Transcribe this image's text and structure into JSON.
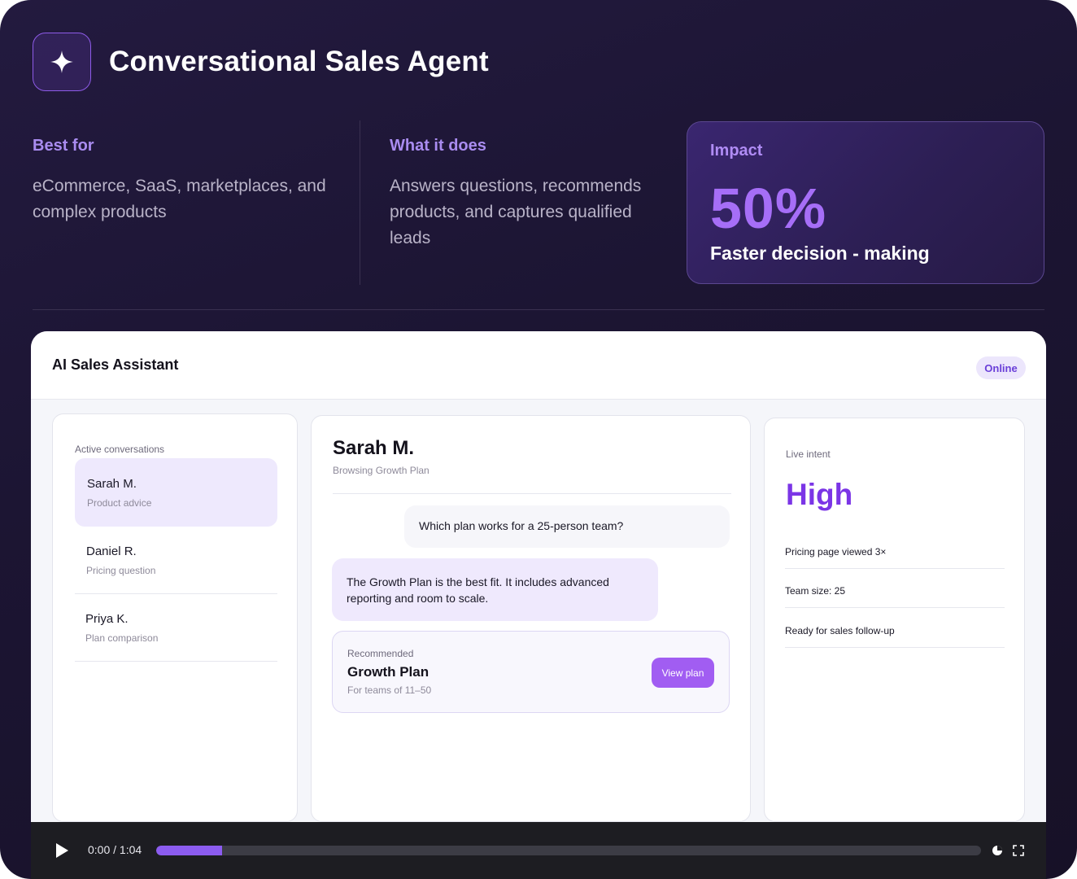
{
  "header": {
    "title": "Conversational Sales Agent",
    "logo_icon": "sparkle-icon"
  },
  "info": {
    "best_for": {
      "label": "Best for",
      "text": "eCommerce, SaaS, marketplaces, and complex products"
    },
    "what_it_does": {
      "label": "What it does",
      "text": "Answers questions, recommends products, and captures qualified leads"
    },
    "impact": {
      "label": "Impact",
      "value": "50%",
      "caption": "Faster decision - making"
    }
  },
  "app": {
    "title": "AI Sales Assistant",
    "status_badge": "Online",
    "conversations": {
      "label": "Active conversations",
      "items": [
        {
          "name": "Sarah M.",
          "topic": "Product advice"
        },
        {
          "name": "Daniel R.",
          "topic": "Pricing question"
        },
        {
          "name": "Priya K.",
          "topic": "Plan comparison"
        }
      ]
    },
    "chat": {
      "name": "Sarah M.",
      "subtitle": "Browsing Growth Plan",
      "user_message": "Which plan works for a 25-person team?",
      "ai_message": "The Growth Plan is the best fit. It includes advanced reporting and room to scale.",
      "recommendation": {
        "label": "Recommended",
        "name": "Growth Plan",
        "detail": "For teams of 11–50",
        "button": "View plan"
      }
    },
    "intent": {
      "label": "Live intent",
      "value": "High",
      "signals": [
        "Pricing page viewed 3×",
        "Team size: 25",
        "Ready for sales follow-up"
      ]
    }
  },
  "player": {
    "time": "0:00 / 1:04",
    "progress": 0.08,
    "icons": [
      "play-icon",
      "settings-icon",
      "fullscreen-icon"
    ]
  },
  "colors": {
    "accent": "#a15df2",
    "impact_value": "#a66ef7",
    "intent_value": "#7b35e6"
  }
}
